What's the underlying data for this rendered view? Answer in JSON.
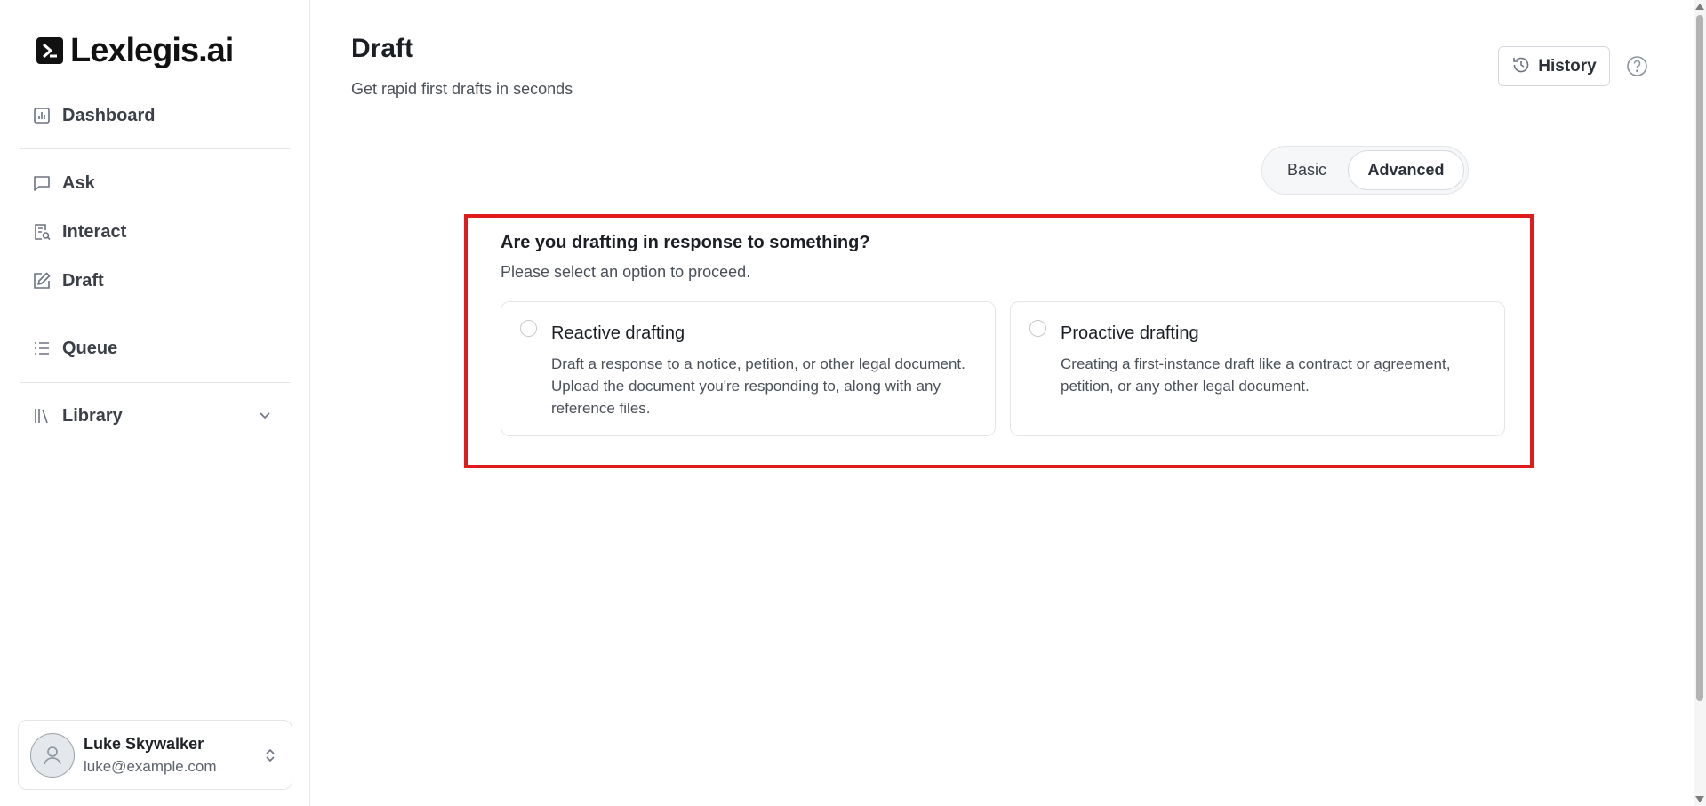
{
  "app": {
    "logo_text": "Lexlegis.ai"
  },
  "sidebar": {
    "items": [
      {
        "label": "Dashboard",
        "icon": "chart-icon"
      },
      {
        "label": "Ask",
        "icon": "message-icon"
      },
      {
        "label": "Interact",
        "icon": "document-search-icon"
      },
      {
        "label": "Draft",
        "icon": "edit-icon"
      },
      {
        "label": "Queue",
        "icon": "list-icon"
      },
      {
        "label": "Library",
        "icon": "library-icon"
      }
    ]
  },
  "user": {
    "name": "Luke Skywalker",
    "email": "luke@example.com"
  },
  "header": {
    "title": "Draft",
    "subtitle": "Get rapid first drafts in seconds",
    "history_label": "History"
  },
  "mode_toggle": {
    "options": [
      "Basic",
      "Advanced"
    ],
    "selected": "Advanced"
  },
  "question": {
    "title": "Are you drafting in response to something?",
    "subtitle": "Please select an option to proceed."
  },
  "options": [
    {
      "title": "Reactive drafting",
      "description": "Draft a response to a notice, petition, or other legal document. Upload the document you're responding to, along with any reference files."
    },
    {
      "title": "Proactive drafting",
      "description": "Creating a first-instance draft like a contract or agreement, petition, or any other legal document."
    }
  ],
  "colors": {
    "highlight_border": "#e01b1b",
    "text_primary": "#1b1f24",
    "text_secondary": "#4a5058"
  }
}
